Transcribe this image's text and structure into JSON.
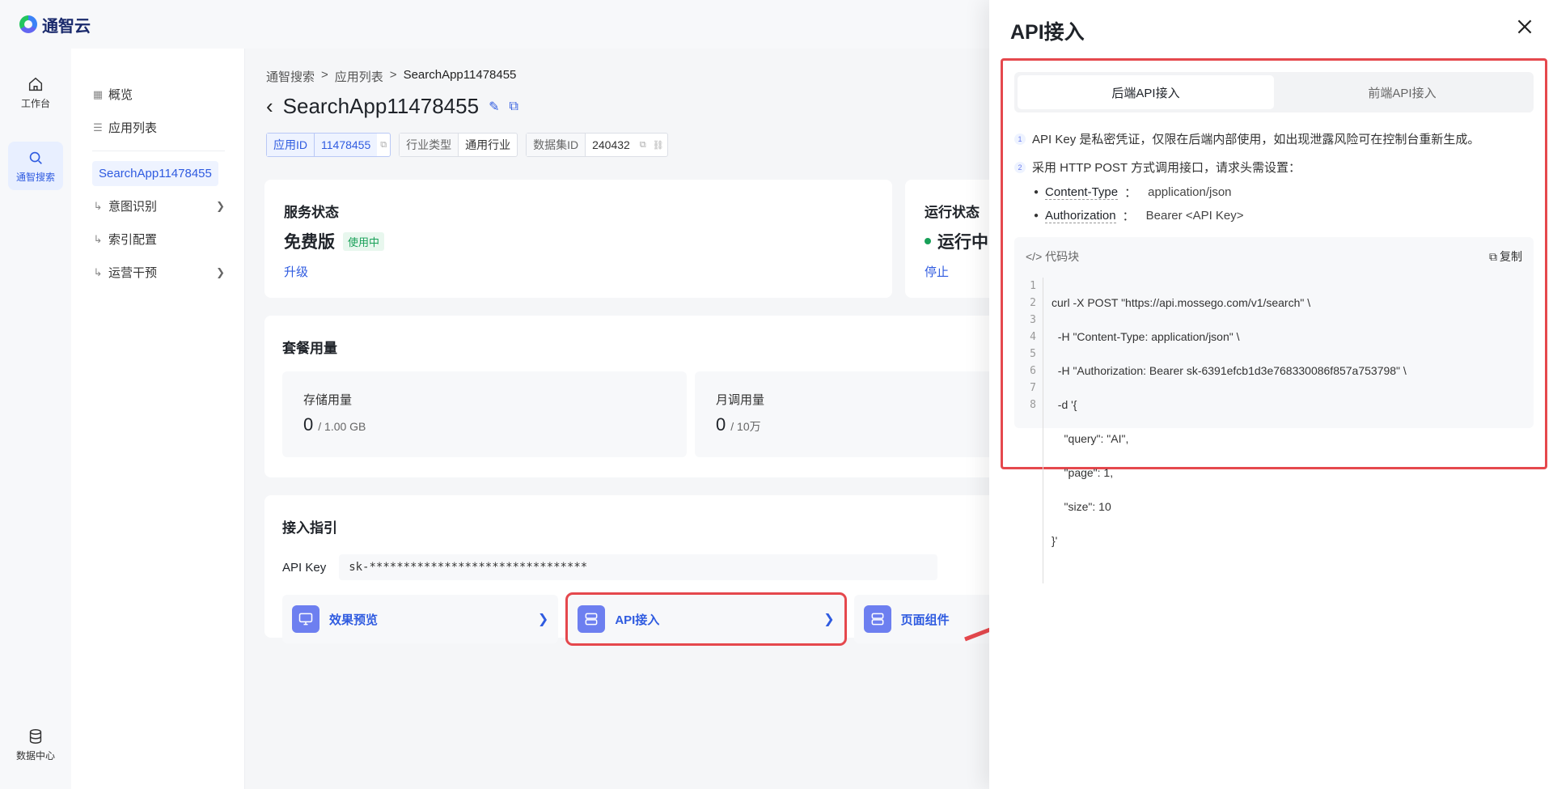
{
  "brand": {
    "name": "通智云"
  },
  "rail": {
    "items": [
      {
        "label": "工作台",
        "icon": "home-icon"
      },
      {
        "label": "通智搜索",
        "icon": "search-icon"
      },
      {
        "label": "数据中心",
        "icon": "database-icon"
      }
    ]
  },
  "subnav": {
    "overview": "概览",
    "app_list": "应用列表",
    "current_app": "SearchApp11478455",
    "intent": "意图识别",
    "index": "索引配置",
    "ops": "运营干预"
  },
  "breadcrumb": {
    "a": "通智搜索",
    "b": "应用列表",
    "c": "SearchApp11478455",
    "sep": ">"
  },
  "page": {
    "title": "SearchApp11478455"
  },
  "tags": {
    "app_id_k": "应用ID",
    "app_id_v": "11478455",
    "industry_k": "行业类型",
    "industry_v": "通用行业",
    "dataset_k": "数据集ID",
    "dataset_v": "240432"
  },
  "service": {
    "title": "服务状态",
    "plan": "免费版",
    "badge": "使用中",
    "upgrade": "升级"
  },
  "run": {
    "title": "运行状态",
    "state": "运行中",
    "stop": "停止"
  },
  "usage": {
    "title": "套餐用量",
    "storage_label": "存储用量",
    "storage_val": "0",
    "storage_max": "/ 1.00 GB",
    "calls_label": "月调用量",
    "calls_val": "0",
    "calls_max": "/ 10万"
  },
  "guide": {
    "title": "接入指引",
    "key_label": "API Key",
    "key_value": "sk-********************************",
    "entry1": "效果预览",
    "entry2": "API接入",
    "entry3": "页面组件"
  },
  "drawer": {
    "title": "API接入",
    "tab_backend": "后端API接入",
    "tab_frontend": "前端API接入",
    "note1": "API Key 是私密凭证，仅限在后端内部使用，如出现泄露风险可在控制台重新生成。",
    "note2": "采用 HTTP POST 方式调用接口，请求头需设置：",
    "h1_k": "Content-Type",
    "h1_v": "application/json",
    "h2_k": "Authorization",
    "h2_v": "Bearer <API Key>",
    "code_label": "代码块",
    "copy": "复制",
    "code": [
      "curl -X POST \"https://api.mossego.com/v1/search\" \\",
      "  -H \"Content-Type: application/json\" \\",
      "  -H \"Authorization: Bearer sk-6391efcb1d3e768330086f857a753798\" \\",
      "  -d '{",
      "    \"query\": \"AI\",",
      "    \"page\": 1,",
      "    \"size\": 10",
      "}'"
    ]
  },
  "colors": {
    "accent": "#2f5be0",
    "highlight": "#e5484d",
    "success": "#18a058"
  }
}
